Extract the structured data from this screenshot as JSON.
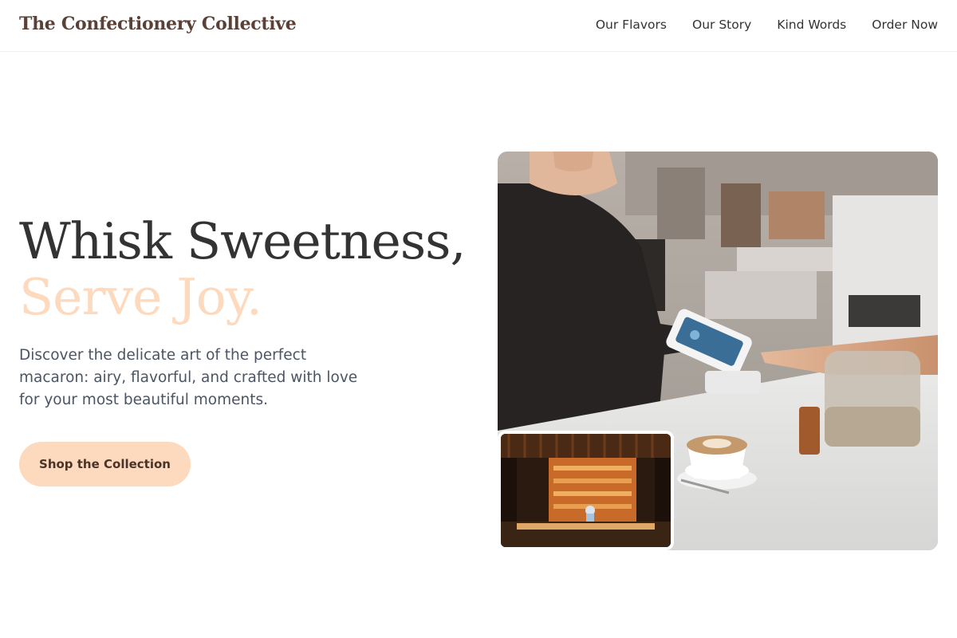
{
  "header": {
    "brand": "The Confectionery Collective",
    "nav": [
      {
        "label": "Our Flavors"
      },
      {
        "label": "Our Story"
      },
      {
        "label": "Kind Words"
      },
      {
        "label": "Order Now"
      }
    ]
  },
  "hero": {
    "headline_line1": "Whisk Sweetness,",
    "headline_line2": "Serve Joy.",
    "description": "Discover the delicate art of the perfect macaron: airy, flavorful, and crafted with love for your most beautiful moments.",
    "cta_label": "Shop the Collection"
  },
  "images": {
    "main": "cafe-counter-card-payment-photo",
    "inset": "bakery-display-case-photo"
  },
  "colors": {
    "brand": "#5a4036",
    "accent": "#fdd9bd",
    "text": "#333333",
    "muted": "#4b5563"
  }
}
